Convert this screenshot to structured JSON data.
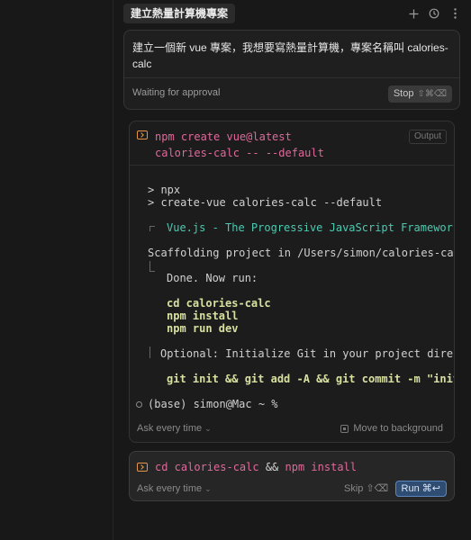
{
  "chat": {
    "tab_title": "建立熱量計算機專案",
    "prompt": "建立一個新 vue 專案，我想要寫熱量計算機，專案名稱叫 calories-calc",
    "status": "Waiting for approval",
    "stop_label": "Stop",
    "stop_shortcut": "⇧⌘⌫"
  },
  "terminal": {
    "command_line1": "npm create vue@latest",
    "command_line2": "calories-calc -- --default",
    "output_label": "Output",
    "lines": {
      "l1": "> npx",
      "l2": "> create-vue calories-calc --default",
      "l3": "Vue.js - The Progressive JavaScript Framework",
      "l4": "Scaffolding project in /Users/simon/calories-calc...",
      "l5": "Done. Now run:",
      "l6": "cd calories-calc",
      "l7": "npm install",
      "l8": "npm run dev",
      "l9": "Optional: Initialize Git in your project directory with:",
      "l10": "git init && git add -A && git commit -m \"initial commit\"",
      "l11": "(base) simon@Mac ~ %"
    },
    "ask_label": "Ask every time",
    "background_label": "Move to background"
  },
  "pending": {
    "cmd_a": "cd calories-calc",
    "cmd_op": "&&",
    "cmd_b": "npm install",
    "ask_label": "Ask every time",
    "skip_label": "Skip ⇧⌫",
    "run_label": "Run ⌘↩"
  },
  "icons": {
    "header": [
      "plus-icon",
      "history-icon",
      "more-icon"
    ],
    "terminal": "terminal-icon"
  },
  "colors": {
    "accent_orange": "#e5954a",
    "command_pink": "#e0699b",
    "vue_green": "#4ec9b0",
    "run_blue": "#2f4c72"
  }
}
